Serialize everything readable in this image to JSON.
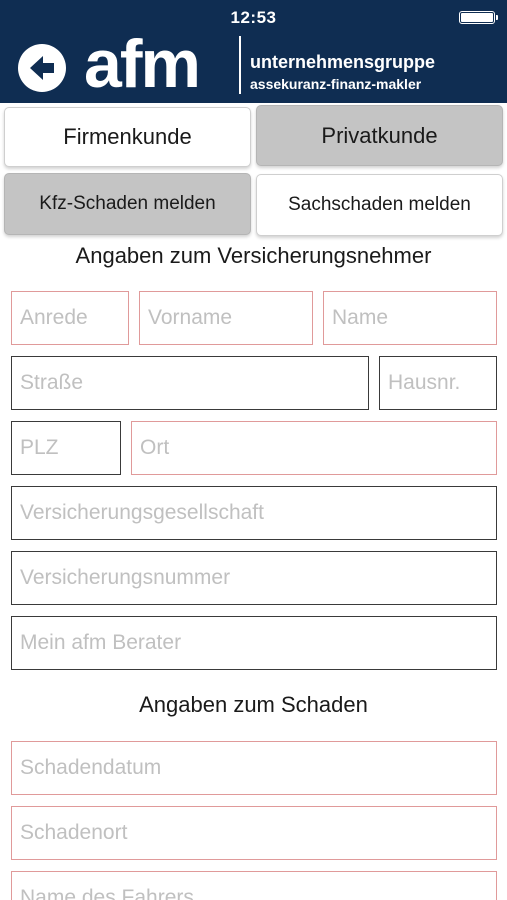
{
  "status_bar": {
    "time": "12:53"
  },
  "header": {
    "logo_text": "afm",
    "logo_line1": "unternehmensgruppe",
    "logo_line2": "assekuranz-finanz-makler"
  },
  "customer_type": {
    "firmenkunde_label": "Firmenkunde",
    "privatkunde_label": "Privatkunde",
    "selected": "Privatkunde"
  },
  "claim_type": {
    "kfz_label": "Kfz-Schaden melden",
    "sach_label": "Sachschaden melden",
    "selected": "Kfz-Schaden melden"
  },
  "section_policyholder": {
    "title": "Angaben zum Versicherungsnehmer",
    "fields": {
      "anrede": "Anrede",
      "vorname": "Vorname",
      "name": "Name",
      "strasse": "Straße",
      "hausnr": "Hausnr.",
      "plz": "PLZ",
      "ort": "Ort",
      "versicherungsgesellschaft": "Versicherungsgesellschaft",
      "versicherungsnummer": "Versicherungsnummer",
      "berater": "Mein afm Berater"
    }
  },
  "section_damage": {
    "title": "Angaben zum Schaden",
    "fields": {
      "schadendatum": "Schadendatum",
      "schadenort": "Schadenort",
      "fahrer": "Name des Fahrers"
    }
  },
  "colors": {
    "header_bg": "#0f2d52",
    "selected_button": "#c4c4c4",
    "required_border": "#e09a9a",
    "default_border": "#3a3a3a",
    "placeholder": "#c0c0c0"
  },
  "icons": {
    "back": "back-arrow-circle-icon",
    "battery": "battery-icon"
  }
}
